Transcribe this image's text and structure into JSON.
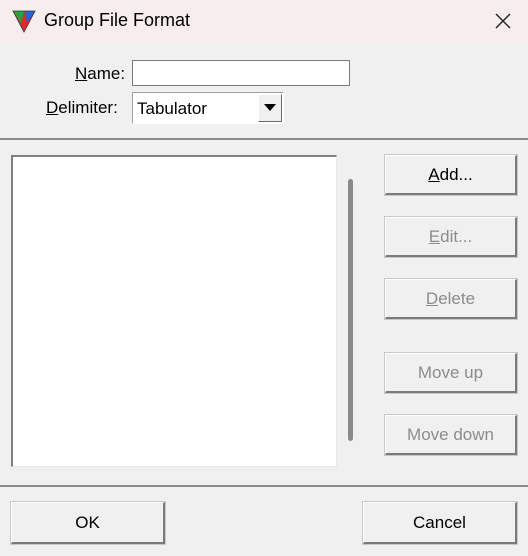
{
  "window": {
    "title": "Group File Format",
    "app_icon": "tri-color-triangle-icon",
    "close_icon": "close-icon"
  },
  "form": {
    "name_label_accel": "N",
    "name_label_rest": "ame:",
    "name_value": "",
    "delimiter_label_accel": "D",
    "delimiter_label_rest": "elimiter:",
    "delimiter_value": "Tabulator"
  },
  "side_buttons": {
    "add_accel": "A",
    "add_rest": "dd...",
    "edit_accel": "E",
    "edit_rest": "dit...",
    "delete_accel": "D",
    "delete_rest": "elete",
    "move_up": "Move up",
    "move_down": "Move down"
  },
  "footer": {
    "ok": "OK",
    "cancel": "Cancel"
  },
  "colors": {
    "titlebar_bg": "#f7eded",
    "window_bg": "#f0f0f0",
    "disabled_text": "#8c8c8c"
  }
}
